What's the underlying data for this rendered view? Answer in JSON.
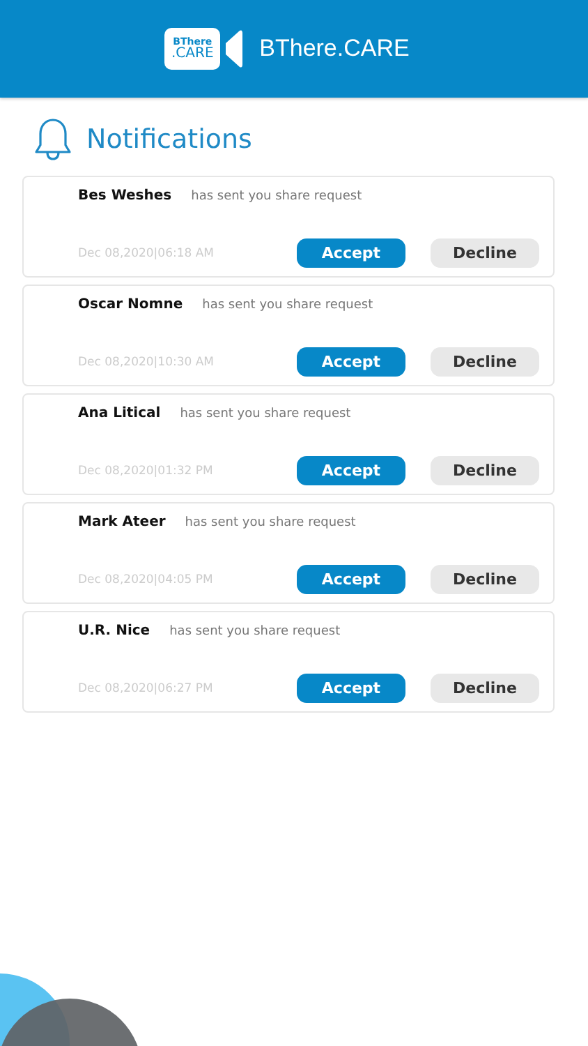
{
  "header": {
    "logo_top": "BThere",
    "logo_bottom": ".CARE",
    "title": "BThere.CARE"
  },
  "page_title": "Notifications",
  "notifications": [
    {
      "name": "Bes Weshes",
      "message": "has sent you share request",
      "time": "Dec 08,2020|06:18 AM",
      "accept": "Accept",
      "decline": "Decline"
    },
    {
      "name": "Oscar Nomne",
      "message": "has sent you share request",
      "time": "Dec 08,2020|10:30 AM",
      "accept": "Accept",
      "decline": "Decline"
    },
    {
      "name": "Ana Litical",
      "message": "has sent you share request",
      "time": "Dec 08,2020|01:32 PM",
      "accept": "Accept",
      "decline": "Decline"
    },
    {
      "name": "Mark Ateer",
      "message": "has sent you share request",
      "time": "Dec 08,2020|04:05 PM",
      "accept": "Accept",
      "decline": "Decline"
    },
    {
      "name": "U.R. Nice",
      "message": "has sent you share request",
      "time": "Dec 08,2020|06:27 PM",
      "accept": "Accept",
      "decline": "Decline"
    }
  ]
}
